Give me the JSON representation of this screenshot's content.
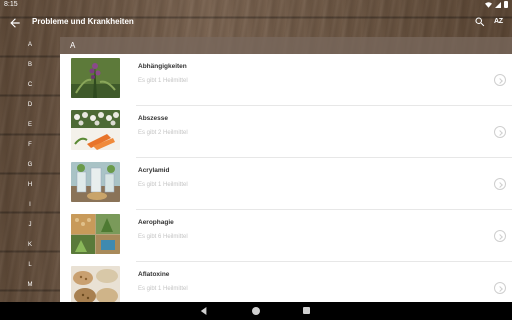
{
  "status_bar": {
    "time": "8:15"
  },
  "app_bar": {
    "title": "Probleme und Krankheiten",
    "sort_label": "AZ"
  },
  "alphabet_index": [
    "A",
    "B",
    "C",
    "D",
    "E",
    "F",
    "G",
    "H",
    "I",
    "J",
    "K",
    "L",
    "M"
  ],
  "section": {
    "letter": "A"
  },
  "items": [
    {
      "title": "Abhängigkeiten",
      "subtitle": "Es gibt 1 Heilmittel"
    },
    {
      "title": "Abszesse",
      "subtitle": "Es gibt 2 Heilmittel"
    },
    {
      "title": "Acrylamid",
      "subtitle": "Es gibt 1 Heilmittel"
    },
    {
      "title": "Aerophagie",
      "subtitle": "Es gibt 6 Heilmittel"
    },
    {
      "title": "Aflatoxine",
      "subtitle": "Es gibt 1 Heilmittel"
    }
  ],
  "icons": {
    "back": "arrow-left-icon",
    "search": "search-icon",
    "chevron": "chevron-right-circle-icon"
  },
  "colors": {
    "list_background": "#ffffff",
    "title_text": "#333333",
    "subtitle_text": "#c4c4c4",
    "nav_bar": "#000000"
  }
}
